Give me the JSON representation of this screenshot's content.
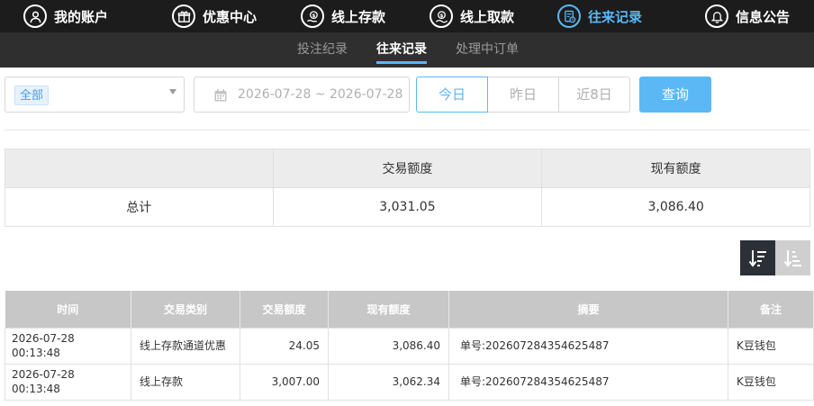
{
  "top_nav": [
    {
      "label": "我的账户",
      "icon": "user-icon",
      "active": false
    },
    {
      "label": "优惠中心",
      "icon": "gift-icon",
      "active": false
    },
    {
      "label": "线上存款",
      "icon": "deposit-icon",
      "active": false
    },
    {
      "label": "线上取款",
      "icon": "withdraw-icon",
      "active": false
    },
    {
      "label": "往来记录",
      "icon": "record-icon",
      "active": true
    },
    {
      "label": "信息公告",
      "icon": "bell-icon",
      "active": false
    }
  ],
  "sub_nav": [
    {
      "label": "投注纪录",
      "active": false
    },
    {
      "label": "往来记录",
      "active": true
    },
    {
      "label": "处理中订单",
      "active": false
    }
  ],
  "filters": {
    "type_selected": "全部",
    "date_range": "2026-07-28 ~ 2026-07-28",
    "quick_buttons": [
      "今日",
      "昨日",
      "近8日"
    ],
    "query_label": "查询"
  },
  "summary": {
    "headers": [
      "",
      "交易额度",
      "现有额度"
    ],
    "row": {
      "label": "总计",
      "amount": "3,031.05",
      "balance": "3,086.40"
    }
  },
  "records": {
    "headers": [
      "时间",
      "交易类别",
      "交易额度",
      "现有额度",
      "摘要",
      "备注"
    ],
    "rows": [
      {
        "time": "2026-07-28 00:13:48",
        "type": "线上存款通道优惠",
        "amount": "24.05",
        "balance": "3,086.40",
        "summary": "单号:202607284354625487",
        "note": "K豆钱包"
      },
      {
        "time": "2026-07-28 00:13:48",
        "type": "线上存款",
        "amount": "3,007.00",
        "balance": "3,062.34",
        "summary": "单号:202607284354625487",
        "note": "K豆钱包"
      }
    ]
  },
  "colors": {
    "accent": "#5bb8f5",
    "nav_bg": "#1c1c1c",
    "subnav_bg": "#2f2f2f",
    "header_gray": "#c7c7c7"
  }
}
